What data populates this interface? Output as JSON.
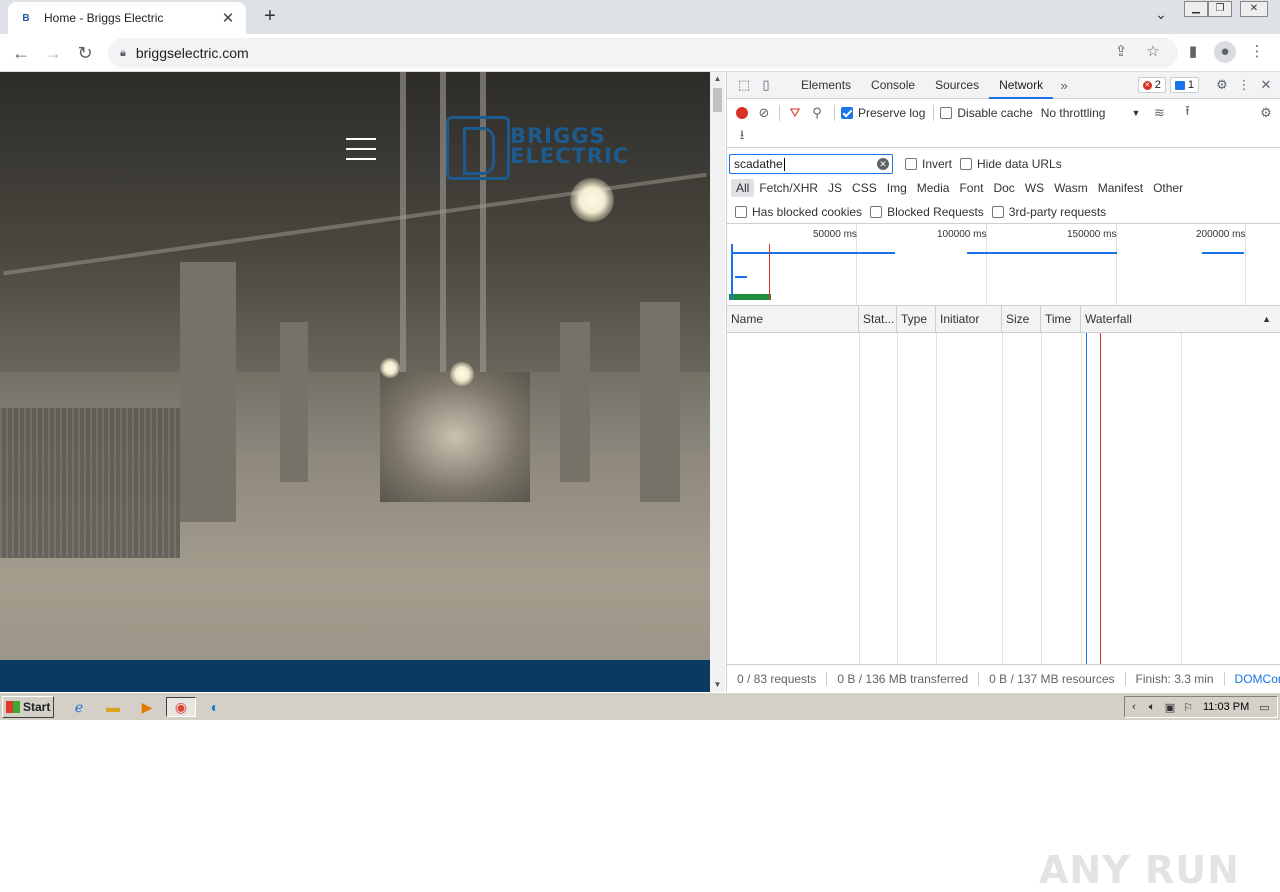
{
  "browser": {
    "tab_title": "Home - Briggs Electric",
    "favicon": "B",
    "url": "briggselectric.com"
  },
  "website": {
    "logo_line1": "BRIGGS",
    "logo_line2": "ELECTRIC"
  },
  "devtools": {
    "tabs": [
      {
        "label": "Elements"
      },
      {
        "label": "Console"
      },
      {
        "label": "Sources"
      },
      {
        "label": "Network"
      }
    ],
    "active_tab": "Network",
    "errors_count": "2",
    "messages_count": "1",
    "toolbar": {
      "preserve_log_label": "Preserve log",
      "preserve_log_checked": true,
      "disable_cache_label": "Disable cache",
      "throttling_value": "No throttling"
    },
    "filter": {
      "value": "scadathe",
      "invert_label": "Invert",
      "hide_data_urls_label": "Hide data URLs"
    },
    "type_filters": [
      "All",
      "Fetch/XHR",
      "JS",
      "CSS",
      "Img",
      "Media",
      "Font",
      "Doc",
      "WS",
      "Wasm",
      "Manifest",
      "Other"
    ],
    "active_type": "All",
    "blocked_filters": {
      "has_blocked_cookies": "Has blocked cookies",
      "blocked_requests": "Blocked Requests",
      "third_party": "3rd-party requests"
    },
    "overview_labels": [
      "50000 ms",
      "100000 ms",
      "150000 ms",
      "200000 ms"
    ],
    "columns": [
      "Name",
      "Stat...",
      "Type",
      "Initiator",
      "Size",
      "Time",
      "Waterfall"
    ],
    "status": {
      "requests": "0 / 83 requests",
      "transferred": "0 B / 136 MB transferred",
      "resources": "0 B / 137 MB resources",
      "finish": "Finish: 3.3 min",
      "domcontent": "DOMConte"
    },
    "watermark": "ANY RUN"
  },
  "taskbar": {
    "start_label": "Start",
    "clock": "11:03 PM"
  }
}
